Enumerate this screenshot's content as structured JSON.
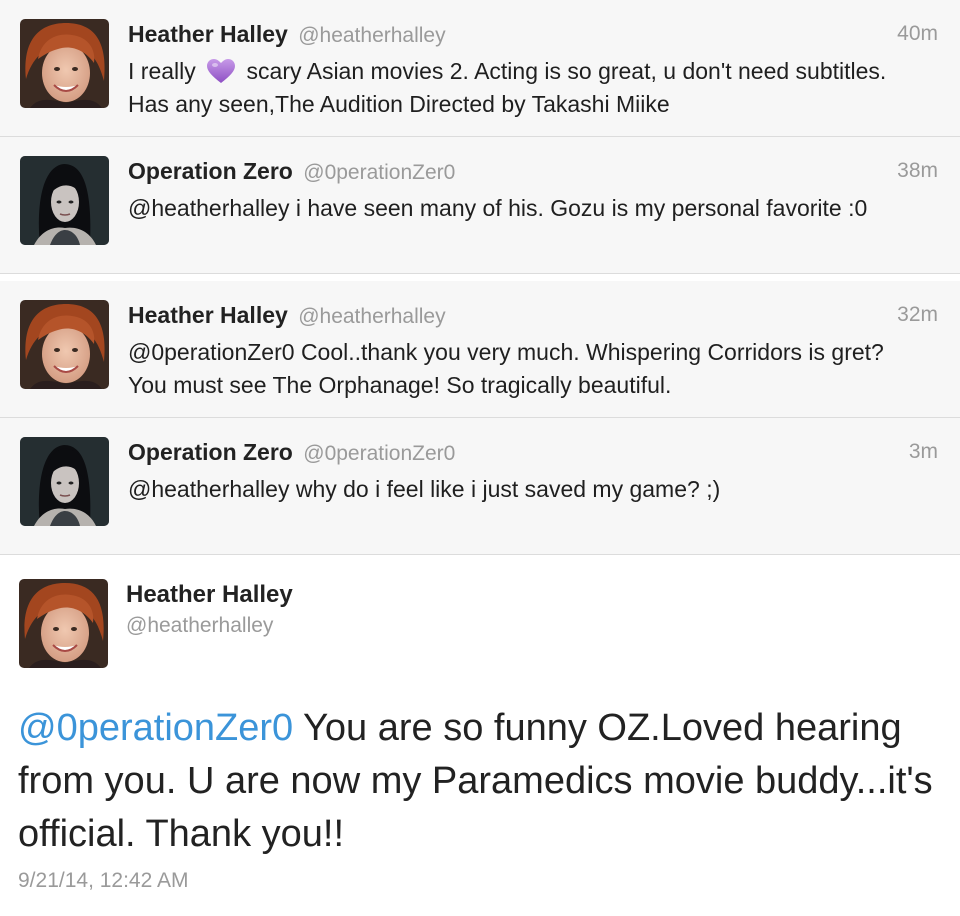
{
  "tweets": [
    {
      "name": "Heather Halley",
      "handle": "@heatherhalley",
      "time": "40m",
      "text_before": "I really",
      "icon": "purple-heart-icon",
      "text_after": "scary Asian movies 2. Acting is so great, u don't need subtitles. Has any seen,The Audition Directed by Takashi Miike"
    },
    {
      "name": "Operation Zero",
      "handle": "@0perationZer0",
      "time": "38m",
      "text": "@heatherhalley i have seen many of his.  Gozu is my personal favorite :0"
    },
    {
      "name": "Heather Halley",
      "handle": "@heatherhalley",
      "time": "32m",
      "text": "@0perationZer0 Cool..thank you very much. Whispering Corridors is gret?  You must see The Orphanage! So tragically beautiful."
    },
    {
      "name": "Operation Zero",
      "handle": "@0perationZer0",
      "time": "3m",
      "text": "@heatherhalley why do i feel like i just saved my game?  ;)"
    }
  ],
  "detail": {
    "name": "Heather Halley",
    "handle": "@heatherhalley",
    "mention": "@0perationZer0",
    "text": " You are so funny OZ.Loved hearing from you. U are now my Paramedics movie buddy...it's official. Thank you!!",
    "timestamp": "9/21/14, 12:42 AM"
  },
  "colors": {
    "mention": "#3b94d9",
    "heart": "#a66bd6",
    "meta_gray": "#9a9a9a",
    "row_bg": "#f7f7f7"
  }
}
